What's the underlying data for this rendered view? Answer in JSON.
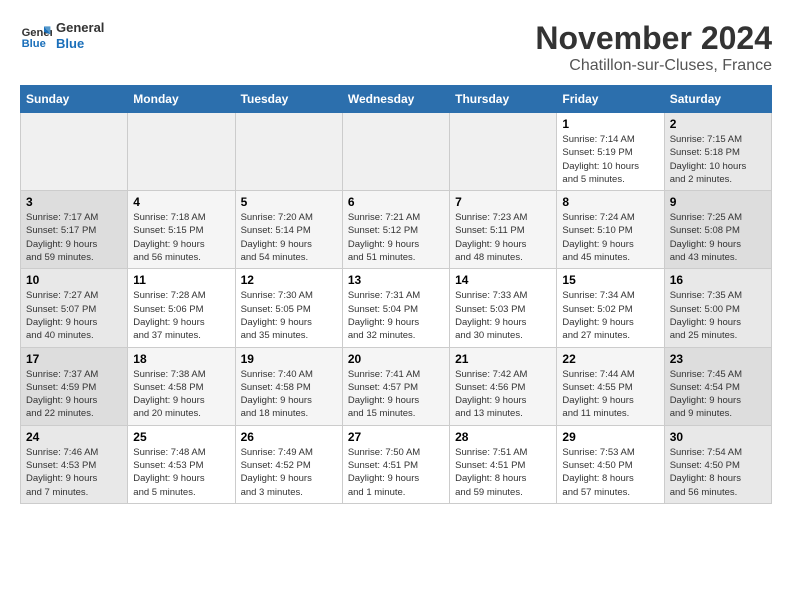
{
  "logo": {
    "text_general": "General",
    "text_blue": "Blue"
  },
  "title": {
    "month": "November 2024",
    "location": "Chatillon-sur-Cluses, France"
  },
  "weekdays": [
    "Sunday",
    "Monday",
    "Tuesday",
    "Wednesday",
    "Thursday",
    "Friday",
    "Saturday"
  ],
  "weeks": [
    [
      {
        "day": "",
        "info": ""
      },
      {
        "day": "",
        "info": ""
      },
      {
        "day": "",
        "info": ""
      },
      {
        "day": "",
        "info": ""
      },
      {
        "day": "",
        "info": ""
      },
      {
        "day": "1",
        "info": "Sunrise: 7:14 AM\nSunset: 5:19 PM\nDaylight: 10 hours\nand 5 minutes."
      },
      {
        "day": "2",
        "info": "Sunrise: 7:15 AM\nSunset: 5:18 PM\nDaylight: 10 hours\nand 2 minutes."
      }
    ],
    [
      {
        "day": "3",
        "info": "Sunrise: 7:17 AM\nSunset: 5:17 PM\nDaylight: 9 hours\nand 59 minutes."
      },
      {
        "day": "4",
        "info": "Sunrise: 7:18 AM\nSunset: 5:15 PM\nDaylight: 9 hours\nand 56 minutes."
      },
      {
        "day": "5",
        "info": "Sunrise: 7:20 AM\nSunset: 5:14 PM\nDaylight: 9 hours\nand 54 minutes."
      },
      {
        "day": "6",
        "info": "Sunrise: 7:21 AM\nSunset: 5:12 PM\nDaylight: 9 hours\nand 51 minutes."
      },
      {
        "day": "7",
        "info": "Sunrise: 7:23 AM\nSunset: 5:11 PM\nDaylight: 9 hours\nand 48 minutes."
      },
      {
        "day": "8",
        "info": "Sunrise: 7:24 AM\nSunset: 5:10 PM\nDaylight: 9 hours\nand 45 minutes."
      },
      {
        "day": "9",
        "info": "Sunrise: 7:25 AM\nSunset: 5:08 PM\nDaylight: 9 hours\nand 43 minutes."
      }
    ],
    [
      {
        "day": "10",
        "info": "Sunrise: 7:27 AM\nSunset: 5:07 PM\nDaylight: 9 hours\nand 40 minutes."
      },
      {
        "day": "11",
        "info": "Sunrise: 7:28 AM\nSunset: 5:06 PM\nDaylight: 9 hours\nand 37 minutes."
      },
      {
        "day": "12",
        "info": "Sunrise: 7:30 AM\nSunset: 5:05 PM\nDaylight: 9 hours\nand 35 minutes."
      },
      {
        "day": "13",
        "info": "Sunrise: 7:31 AM\nSunset: 5:04 PM\nDaylight: 9 hours\nand 32 minutes."
      },
      {
        "day": "14",
        "info": "Sunrise: 7:33 AM\nSunset: 5:03 PM\nDaylight: 9 hours\nand 30 minutes."
      },
      {
        "day": "15",
        "info": "Sunrise: 7:34 AM\nSunset: 5:02 PM\nDaylight: 9 hours\nand 27 minutes."
      },
      {
        "day": "16",
        "info": "Sunrise: 7:35 AM\nSunset: 5:00 PM\nDaylight: 9 hours\nand 25 minutes."
      }
    ],
    [
      {
        "day": "17",
        "info": "Sunrise: 7:37 AM\nSunset: 4:59 PM\nDaylight: 9 hours\nand 22 minutes."
      },
      {
        "day": "18",
        "info": "Sunrise: 7:38 AM\nSunset: 4:58 PM\nDaylight: 9 hours\nand 20 minutes."
      },
      {
        "day": "19",
        "info": "Sunrise: 7:40 AM\nSunset: 4:58 PM\nDaylight: 9 hours\nand 18 minutes."
      },
      {
        "day": "20",
        "info": "Sunrise: 7:41 AM\nSunset: 4:57 PM\nDaylight: 9 hours\nand 15 minutes."
      },
      {
        "day": "21",
        "info": "Sunrise: 7:42 AM\nSunset: 4:56 PM\nDaylight: 9 hours\nand 13 minutes."
      },
      {
        "day": "22",
        "info": "Sunrise: 7:44 AM\nSunset: 4:55 PM\nDaylight: 9 hours\nand 11 minutes."
      },
      {
        "day": "23",
        "info": "Sunrise: 7:45 AM\nSunset: 4:54 PM\nDaylight: 9 hours\nand 9 minutes."
      }
    ],
    [
      {
        "day": "24",
        "info": "Sunrise: 7:46 AM\nSunset: 4:53 PM\nDaylight: 9 hours\nand 7 minutes."
      },
      {
        "day": "25",
        "info": "Sunrise: 7:48 AM\nSunset: 4:53 PM\nDaylight: 9 hours\nand 5 minutes."
      },
      {
        "day": "26",
        "info": "Sunrise: 7:49 AM\nSunset: 4:52 PM\nDaylight: 9 hours\nand 3 minutes."
      },
      {
        "day": "27",
        "info": "Sunrise: 7:50 AM\nSunset: 4:51 PM\nDaylight: 9 hours\nand 1 minute."
      },
      {
        "day": "28",
        "info": "Sunrise: 7:51 AM\nSunset: 4:51 PM\nDaylight: 8 hours\nand 59 minutes."
      },
      {
        "day": "29",
        "info": "Sunrise: 7:53 AM\nSunset: 4:50 PM\nDaylight: 8 hours\nand 57 minutes."
      },
      {
        "day": "30",
        "info": "Sunrise: 7:54 AM\nSunset: 4:50 PM\nDaylight: 8 hours\nand 56 minutes."
      }
    ]
  ]
}
